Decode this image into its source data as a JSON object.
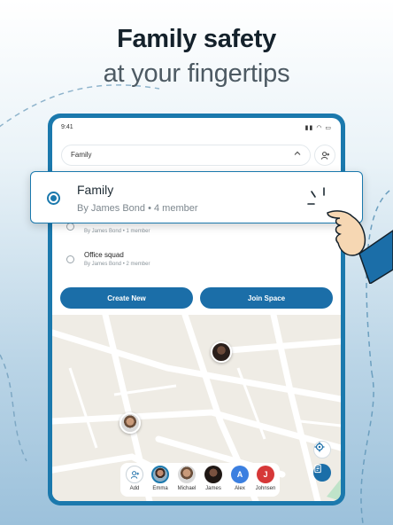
{
  "headline": {
    "line1": "Family safety",
    "line2": "at your fingertips"
  },
  "status_bar": {
    "time": "9:41",
    "icons": [
      "signal-icon",
      "wifi-icon",
      "battery-icon"
    ]
  },
  "space_selector": {
    "selected": "Family",
    "chevron": "chevron-up-icon",
    "add_member_icon": "add-person-icon"
  },
  "spaces": [
    {
      "name": "Family",
      "subtitle": "By James Bond • 4 member",
      "selected": true
    },
    {
      "name": "",
      "subtitle": "By James Bond • 1 member",
      "selected": false
    },
    {
      "name": "Office squad",
      "subtitle": "By James Bond • 2 member",
      "selected": false
    }
  ],
  "popup": {
    "name": "Family",
    "subtitle": "By James Bond  •  4 member"
  },
  "actions": {
    "create_label": "Create New",
    "join_label": "Join Space"
  },
  "map_controls": {
    "locate_icon": "crosshair-icon",
    "info_icon": "document-icon"
  },
  "members": [
    {
      "label": "Add",
      "type": "add",
      "icon": "add-person-icon"
    },
    {
      "label": "Emma",
      "type": "photo"
    },
    {
      "label": "Michael",
      "type": "photo"
    },
    {
      "label": "James",
      "type": "photo"
    },
    {
      "label": "Alex",
      "type": "initial",
      "initial": "A",
      "color": "#3b7fe0"
    },
    {
      "label": "Johnsen",
      "type": "initial",
      "initial": "J",
      "color": "#d63838"
    }
  ],
  "colors": {
    "accent": "#1b79ad",
    "button": "#1b6ea8",
    "map_bg": "#efece5"
  }
}
